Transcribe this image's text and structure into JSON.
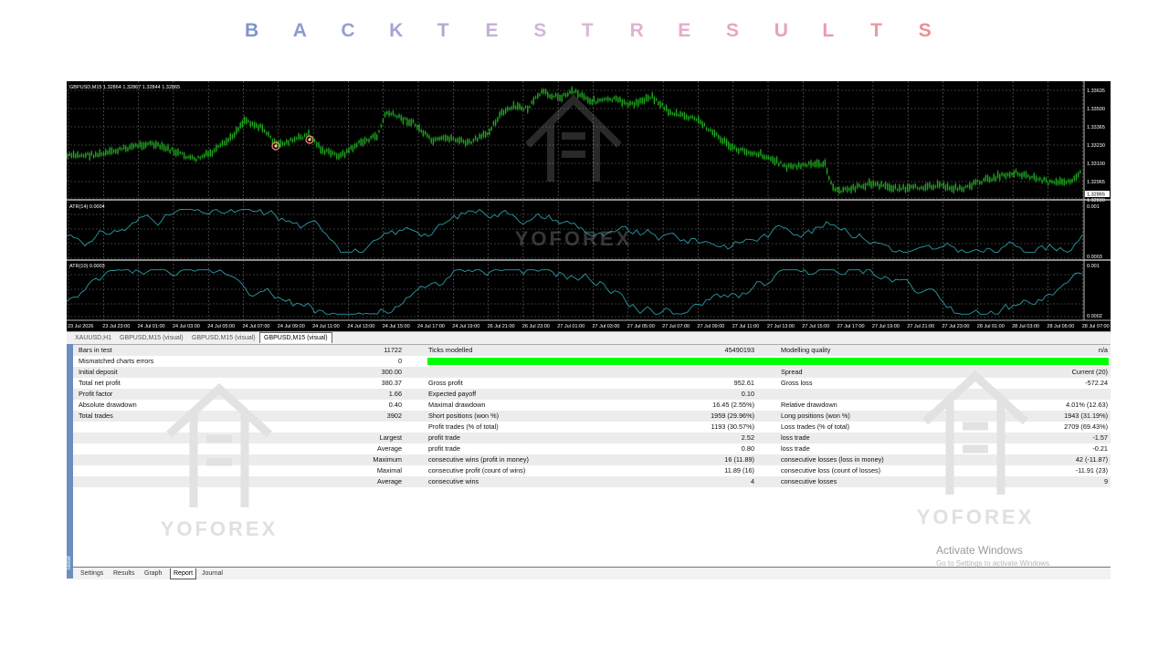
{
  "title_letters": [
    "B",
    "A",
    "C",
    "K",
    "T",
    "E",
    "S",
    "T",
    "R",
    "E",
    "S",
    "U",
    "L",
    "T",
    "S"
  ],
  "title_colors": [
    "#7e96c9",
    "#8a9bcd",
    "#979fd2",
    "#a5a4d6",
    "#b3a9d8",
    "#c3b0da",
    "#d2b5dc",
    "#ddb6da",
    "#e3b2d3",
    "#e5accb",
    "#e7a7c1",
    "#e9a2b6",
    "#eb9cab",
    "#ed97a0",
    "#ef8f94"
  ],
  "chart": {
    "header": "GBPUSD,M15  1.32864 1.32867 1.32844 1.32865",
    "price_labels": [
      "1.33635",
      "1.33500",
      "1.33365",
      "1.33230",
      "1.33100",
      "1.32965",
      "1.32865",
      "1.32830"
    ],
    "atr1_label": "ATR(14) 0.0004",
    "atr1_scale": [
      "0.001",
      "0.0003"
    ],
    "atr2_label": "ATR(10) 0.0003",
    "atr2_scale": [
      "0.001",
      "0.0002"
    ],
    "time_labels": [
      "23 Jul 2026",
      "23 Jul 23:00",
      "24 Jul 01:00",
      "24 Jul 03:00",
      "24 Jul 05:00",
      "24 Jul 07:00",
      "24 Jul 09:00",
      "24 Jul 11:00",
      "24 Jul 13:00",
      "24 Jul 15:00",
      "24 Jul 17:00",
      "24 Jul 19:00",
      "26 Jul 21:00",
      "26 Jul 23:00",
      "27 Jul 01:00",
      "27 Jul 03:00",
      "27 Jul 05:00",
      "27 Jul 07:00",
      "27 Jul 09:00",
      "27 Jul 11:00",
      "27 Jul 13:00",
      "27 Jul 15:00",
      "27 Jul 17:00",
      "27 Jul 19:00",
      "27 Jul 21:00",
      "27 Jul 23:00",
      "28 Jul 01:00",
      "28 Jul 03:00",
      "28 Jul 05:00",
      "28 Jul 07:00"
    ],
    "watermark": "YOFOREX",
    "colors": {
      "candle": "#1faa1f",
      "atr": "#2a9aa6",
      "grid": "#6f6f6f"
    }
  },
  "tabs": [
    "XAUUSD,H1",
    "GBPUSD,M15 (visual)",
    "GBPUSD,M15 (visual)",
    "GBPUSD,M15 (visual)"
  ],
  "active_tab": 3,
  "report": {
    "col1": [
      [
        "Bars in test",
        "11722"
      ],
      [
        "Mismatched charts errors",
        "0"
      ],
      [
        "Initial deposit",
        "300.00"
      ],
      [
        "Total net profit",
        "380.37"
      ],
      [
        "Profit factor",
        "1.66"
      ],
      [
        "Absolute drawdown",
        "0.40"
      ],
      [
        "Total trades",
        "3902"
      ],
      [
        "",
        ""
      ],
      [
        "",
        "Largest"
      ],
      [
        "",
        "Average"
      ],
      [
        "",
        "Maximum"
      ],
      [
        "",
        "Maximal"
      ],
      [
        "",
        "Average"
      ]
    ],
    "col2": [
      [
        "Ticks modelled",
        "45490193"
      ],
      [
        "",
        ""
      ],
      [
        "",
        ""
      ],
      [
        "Gross profit",
        "952.61"
      ],
      [
        "Expected payoff",
        "0.10"
      ],
      [
        "Maximal drawdown",
        "16.45 (2.55%)"
      ],
      [
        "Short positions (won %)",
        "1959 (29.96%)"
      ],
      [
        "Profit trades (% of total)",
        "1193 (30.57%)"
      ],
      [
        "profit trade",
        "2.52"
      ],
      [
        "profit trade",
        "0.80"
      ],
      [
        "consecutive wins (profit in money)",
        "16 (11.89)"
      ],
      [
        "consecutive profit (count of wins)",
        "11.89 (16)"
      ],
      [
        "consecutive wins",
        "4"
      ]
    ],
    "col3": [
      [
        "Modelling quality",
        "n/a"
      ],
      [
        "",
        ""
      ],
      [
        "Spread",
        "Current (20)"
      ],
      [
        "Gross loss",
        "-572.24"
      ],
      [
        "",
        ""
      ],
      [
        "Relative drawdown",
        "4.01% (12.63)"
      ],
      [
        "Long positions (won %)",
        "1943 (31.19%)"
      ],
      [
        "Loss trades (% of total)",
        "2709 (69.43%)"
      ],
      [
        "loss trade",
        "-1.57"
      ],
      [
        "loss trade",
        "-0.21"
      ],
      [
        "consecutive losses (loss in money)",
        "42 (-11.87)"
      ],
      [
        "consecutive loss (count of losses)",
        "-11.91 (23)"
      ],
      [
        "consecutive losses",
        "9"
      ]
    ],
    "quality_bar_color": "#00ff00"
  },
  "side_label": "Tester",
  "bottom_tabs": [
    "Settings",
    "Results",
    "Graph",
    "Report",
    "Journal"
  ],
  "active_bottom_tab": 3,
  "watermark_text": "YOFOREX",
  "activate": {
    "line1": "Activate Windows",
    "line2": "Go to Settings to activate Windows."
  }
}
